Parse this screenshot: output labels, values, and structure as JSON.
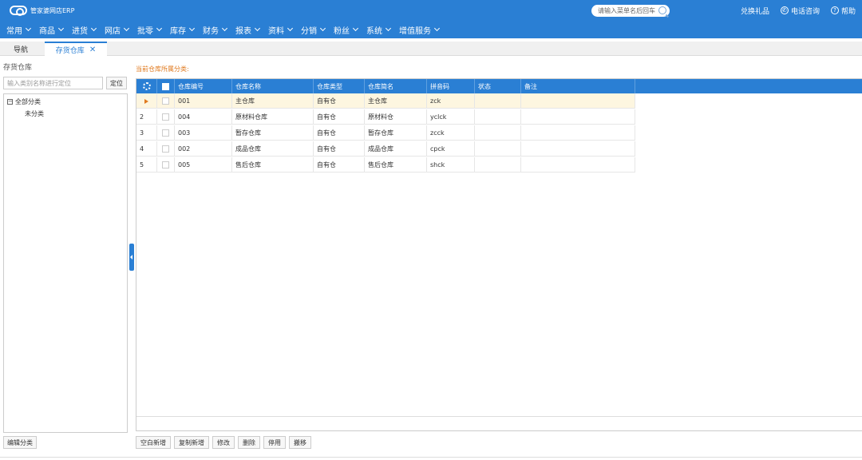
{
  "header": {
    "logo_text": "管家婆网店ERP",
    "search_placeholder": "请输入菜单名后回车",
    "links": [
      {
        "label": "兑换礼品"
      },
      {
        "label": "电话咨询",
        "icon": "phone-icon"
      },
      {
        "label": "帮助",
        "icon": "help-icon"
      }
    ]
  },
  "menu": [
    "常用",
    "商品",
    "进货",
    "网店",
    "批零",
    "库存",
    "财务",
    "报表",
    "资料",
    "分销",
    "粉丝",
    "系统",
    "增值服务"
  ],
  "tabs": {
    "nav": "导航",
    "active": "存货仓库",
    "close": "✕"
  },
  "left": {
    "title": "存货仓库",
    "locate_placeholder": "输入类别名称进行定位",
    "locate_button": "定位",
    "tree": {
      "root": "全部分类",
      "child": "未分类"
    },
    "edit_category_button": "编辑分类"
  },
  "main": {
    "category_label": "当前仓库所属分类:",
    "columns": [
      "仓库编号",
      "仓库名称",
      "仓库类型",
      "仓库简名",
      "拼音码",
      "状态",
      "备注"
    ],
    "rows": [
      {
        "no": "",
        "code": "001",
        "name": "主仓库",
        "type": "自有仓",
        "short": "主仓库",
        "pinyin": "zck",
        "status": "",
        "remark": ""
      },
      {
        "no": "2",
        "code": "004",
        "name": "原材料仓库",
        "type": "自有仓",
        "short": "原材料仓",
        "pinyin": "yclck",
        "status": "",
        "remark": ""
      },
      {
        "no": "3",
        "code": "003",
        "name": "暂存仓库",
        "type": "自有仓",
        "short": "暂存仓库",
        "pinyin": "zcck",
        "status": "",
        "remark": ""
      },
      {
        "no": "4",
        "code": "002",
        "name": "成品仓库",
        "type": "自有仓",
        "short": "成品仓库",
        "pinyin": "cpck",
        "status": "",
        "remark": ""
      },
      {
        "no": "5",
        "code": "005",
        "name": "售后仓库",
        "type": "自有仓",
        "short": "售后仓库",
        "pinyin": "shck",
        "status": "",
        "remark": ""
      }
    ],
    "actions": [
      "空白新增",
      "复制新增",
      "修改",
      "删除",
      "停用",
      "搬移"
    ]
  },
  "colors": {
    "brand": "#2a7fd4",
    "accent": "#e07a1f",
    "selected_row": "#fdf6e0"
  }
}
